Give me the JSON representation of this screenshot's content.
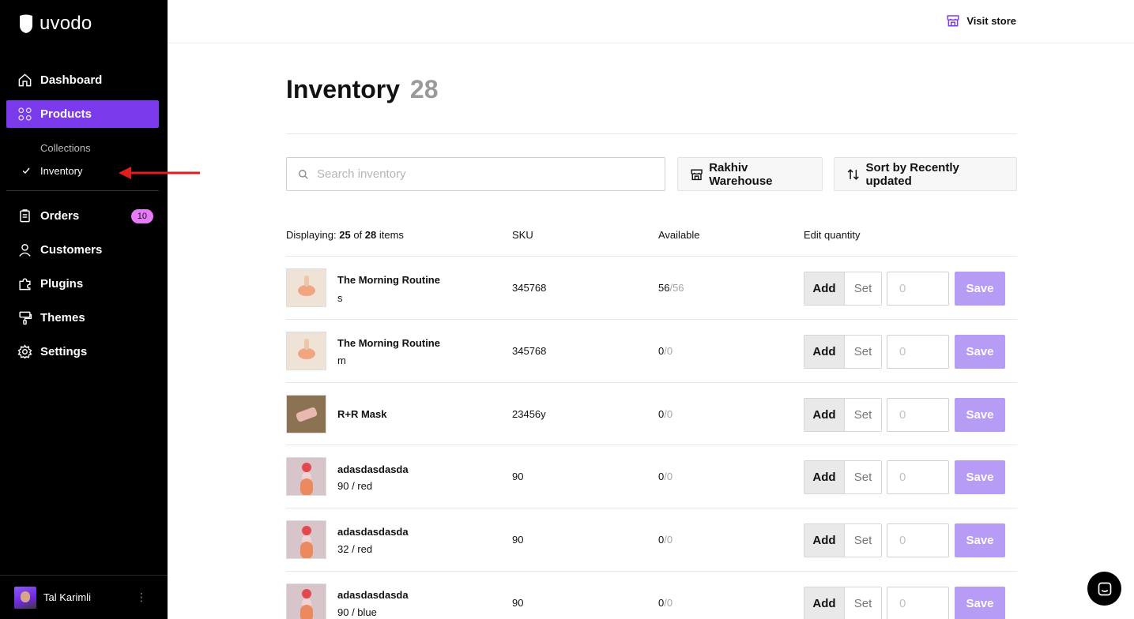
{
  "app": {
    "logo_text": "uvodo"
  },
  "sidebar": {
    "nav": [
      {
        "label": "Dashboard",
        "icon": "home-icon"
      },
      {
        "label": "Products",
        "icon": "grid-icon",
        "active": true
      },
      {
        "label": "Orders",
        "icon": "clipboard-icon",
        "badge": "10"
      },
      {
        "label": "Customers",
        "icon": "user-icon"
      },
      {
        "label": "Plugins",
        "icon": "puzzle-icon"
      },
      {
        "label": "Themes",
        "icon": "paint-roller-icon"
      },
      {
        "label": "Settings",
        "icon": "gear-icon"
      }
    ],
    "products_sub": [
      {
        "label": "Collections"
      },
      {
        "label": "Inventory",
        "selected": true
      }
    ],
    "user": {
      "name": "Tal Karimli"
    }
  },
  "topbar": {
    "visit_store_label": "Visit store"
  },
  "page": {
    "title": "Inventory",
    "count": "28",
    "search_placeholder": "Search inventory",
    "warehouse_label": "Rakhiv Warehouse",
    "sort_label": "Sort by Recently updated"
  },
  "table": {
    "displaying_prefix": "Displaying:",
    "displaying_count": "25",
    "of_word": "of",
    "total_count": "28",
    "items_word": "items",
    "columns": {
      "sku": "SKU",
      "available": "Available",
      "edit_quantity": "Edit quantity"
    },
    "add_label": "Add",
    "set_label": "Set",
    "qty_placeholder": "0",
    "save_label": "Save",
    "rows": [
      {
        "name": "The Morning Routine",
        "variant": "s",
        "sku": "345768",
        "available": "56",
        "total": "/56",
        "thumb": "peach"
      },
      {
        "name": "The Morning Routine",
        "variant": "m",
        "sku": "345768",
        "available": "0",
        "total": "/0",
        "thumb": "peach"
      },
      {
        "name": "R+R Mask",
        "variant": "",
        "sku": "23456y",
        "available": "0",
        "total": "/0",
        "thumb": "mask"
      },
      {
        "name": "adasdasdasda",
        "variant": "90 / red",
        "sku": "90",
        "available": "0",
        "total": "/0",
        "thumb": "stack"
      },
      {
        "name": "adasdasdasda",
        "variant": "32 / red",
        "sku": "90",
        "available": "0",
        "total": "/0",
        "thumb": "stack"
      },
      {
        "name": "adasdasdasda",
        "variant": "90 / blue",
        "sku": "90",
        "available": "0",
        "total": "/0",
        "thumb": "stack"
      }
    ]
  },
  "colors": {
    "sidebar_bg": "#000000",
    "accent": "#7c3aed",
    "badge": "#e879f9",
    "save_button": "#b69cf5",
    "annotation_arrow": "#e11d1d"
  }
}
